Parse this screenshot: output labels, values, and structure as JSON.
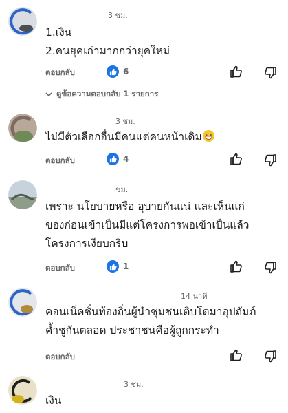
{
  "comments": [
    {
      "time": "3 ชม.",
      "lines": [
        "1.เงิน",
        "2.คนยุคเก่ามากกว่ายุคใหม่"
      ],
      "reply_label": "ตอบกลับ",
      "likes": "6",
      "view_replies": "ดูข้อความตอบกลับ 1 รายการ"
    },
    {
      "time": "3 ชม.",
      "lines": [
        "ไม่มีตัวเลือกอื่นมีคนแต่คนหน้าเดิม"
      ],
      "reply_label": "ตอบกลับ",
      "likes": "4"
    },
    {
      "time": "ชม.",
      "lines": [
        "เพราะ นโยบายหรือ อุบายกันแน่ และเห็นแก่",
        "ของก่อนเข้าเป็นมีแต่โครงการพอเข้าเป็นแล้ว",
        "โครงการเงียบกริบ"
      ],
      "reply_label": "ตอบกลับ",
      "likes": "1"
    },
    {
      "time": "14 นาที",
      "lines": [
        "คอนเน็คชั่นท้องถิ่นผู้นำชุมชนเติบโตมาอุปถัมภ์",
        "ค้ำชูกันตลอด  ประชาชนคือผู้ถูกกระทำ"
      ],
      "reply_label": "ตอบกลับ"
    },
    {
      "time": "3 ชม.",
      "lines": [
        "เงิน"
      ]
    }
  ]
}
